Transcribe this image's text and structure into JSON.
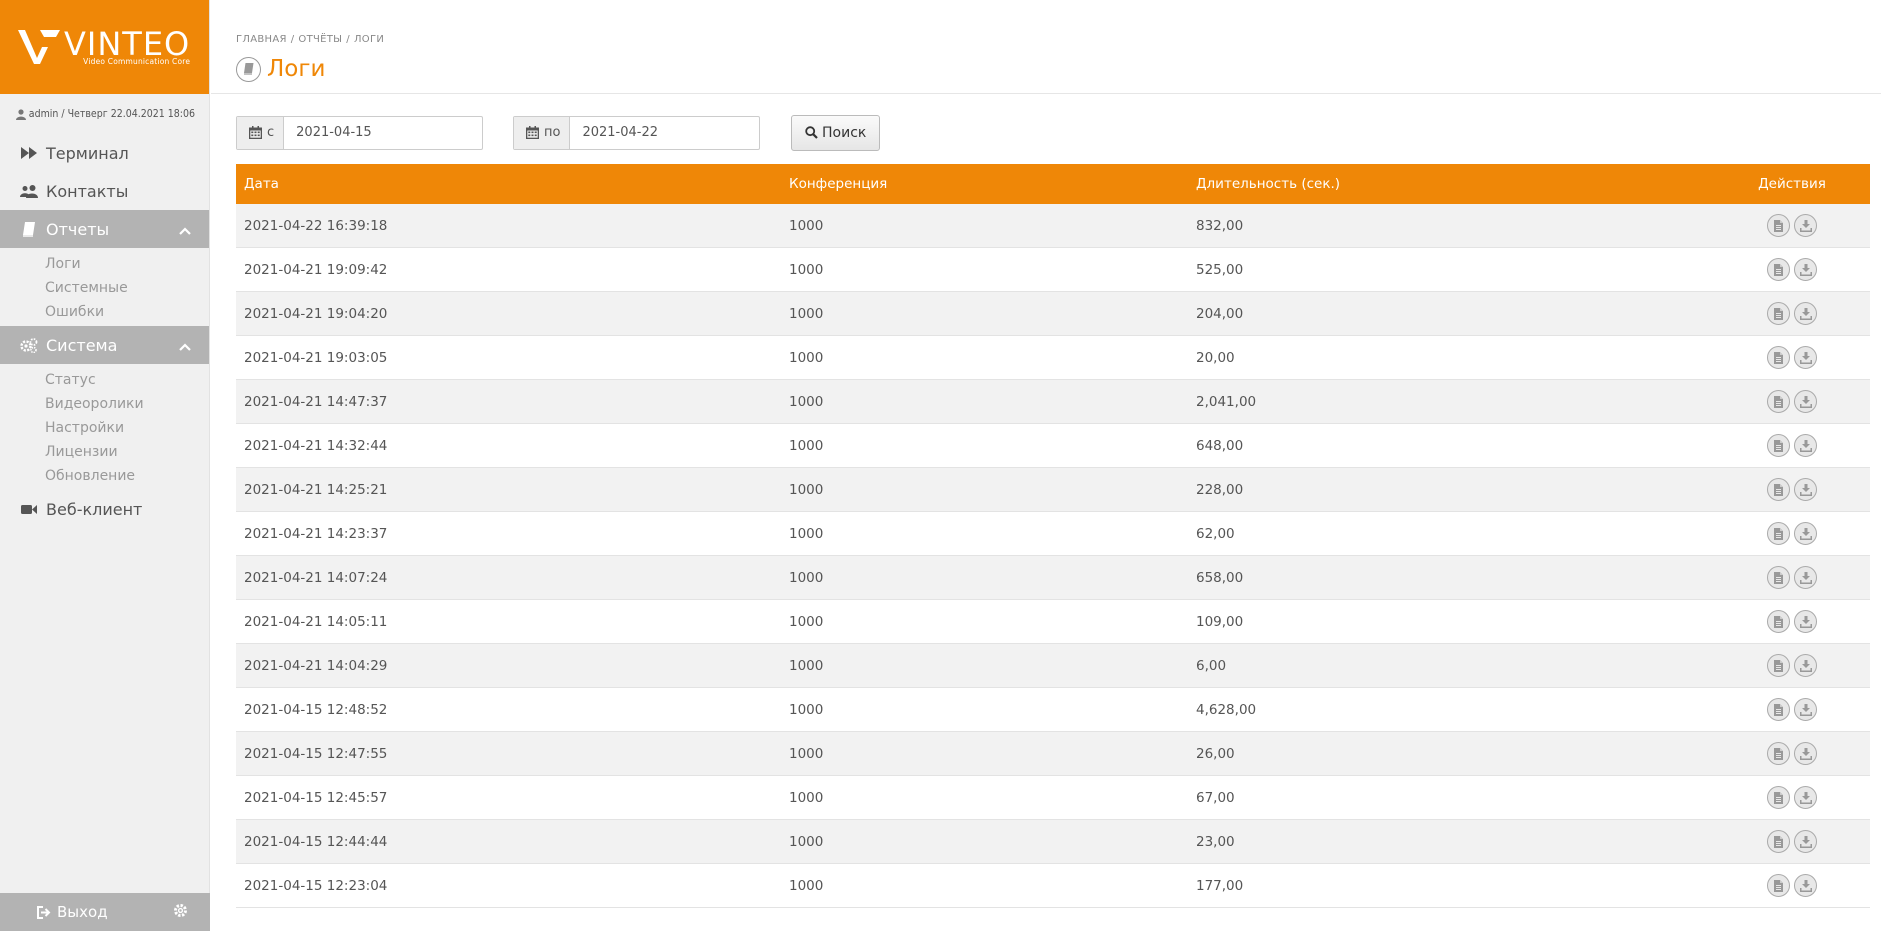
{
  "logo": {
    "brand": "VINTEO",
    "tagline": "Video Communication Core"
  },
  "user": {
    "info": "admin / Четверг 22.04.2021 18:06"
  },
  "nav": {
    "terminal": "Терминал",
    "contacts": "Контакты",
    "reports": {
      "label": "Отчеты",
      "items": [
        "Логи",
        "Системные",
        "Ошибки"
      ]
    },
    "system": {
      "label": "Система",
      "items": [
        "Статус",
        "Видеоролики",
        "Настройки",
        "Лицензии",
        "Обновление"
      ]
    },
    "webclient": "Веб-клиент",
    "exit": "Выход"
  },
  "breadcrumb": {
    "home": "ГЛАВНАЯ",
    "reports": "ОТЧЁТЫ",
    "logs": "ЛОГИ"
  },
  "page": {
    "title": "Логи"
  },
  "filter": {
    "from_label": "с",
    "from_value": "2021-04-15",
    "to_label": "по",
    "to_value": "2021-04-22",
    "search_label": "Поиск"
  },
  "table": {
    "headers": {
      "date": "Дата",
      "conference": "Конференция",
      "duration": "Длительность (сек.)",
      "actions": "Действия"
    },
    "rows": [
      {
        "date": "2021-04-22 16:39:18",
        "conference": "1000",
        "duration": "832,00"
      },
      {
        "date": "2021-04-21 19:09:42",
        "conference": "1000",
        "duration": "525,00"
      },
      {
        "date": "2021-04-21 19:04:20",
        "conference": "1000",
        "duration": "204,00"
      },
      {
        "date": "2021-04-21 19:03:05",
        "conference": "1000",
        "duration": "20,00"
      },
      {
        "date": "2021-04-21 14:47:37",
        "conference": "1000",
        "duration": "2,041,00"
      },
      {
        "date": "2021-04-21 14:32:44",
        "conference": "1000",
        "duration": "648,00"
      },
      {
        "date": "2021-04-21 14:25:21",
        "conference": "1000",
        "duration": "228,00"
      },
      {
        "date": "2021-04-21 14:23:37",
        "conference": "1000",
        "duration": "62,00"
      },
      {
        "date": "2021-04-21 14:07:24",
        "conference": "1000",
        "duration": "658,00"
      },
      {
        "date": "2021-04-21 14:05:11",
        "conference": "1000",
        "duration": "109,00"
      },
      {
        "date": "2021-04-21 14:04:29",
        "conference": "1000",
        "duration": "6,00"
      },
      {
        "date": "2021-04-15 12:48:52",
        "conference": "1000",
        "duration": "4,628,00"
      },
      {
        "date": "2021-04-15 12:47:55",
        "conference": "1000",
        "duration": "26,00"
      },
      {
        "date": "2021-04-15 12:45:57",
        "conference": "1000",
        "duration": "67,00"
      },
      {
        "date": "2021-04-15 12:44:44",
        "conference": "1000",
        "duration": "23,00"
      },
      {
        "date": "2021-04-15 12:23:04",
        "conference": "1000",
        "duration": "177,00"
      }
    ]
  },
  "colors": {
    "accent": "#ef8707",
    "sidebar_bg": "#f0f0f0",
    "sidebar_active": "#b3b3b3",
    "row_alt": "#f2f2f2"
  },
  "icons": {
    "row_actions": [
      "document-icon",
      "download-icon"
    ]
  }
}
